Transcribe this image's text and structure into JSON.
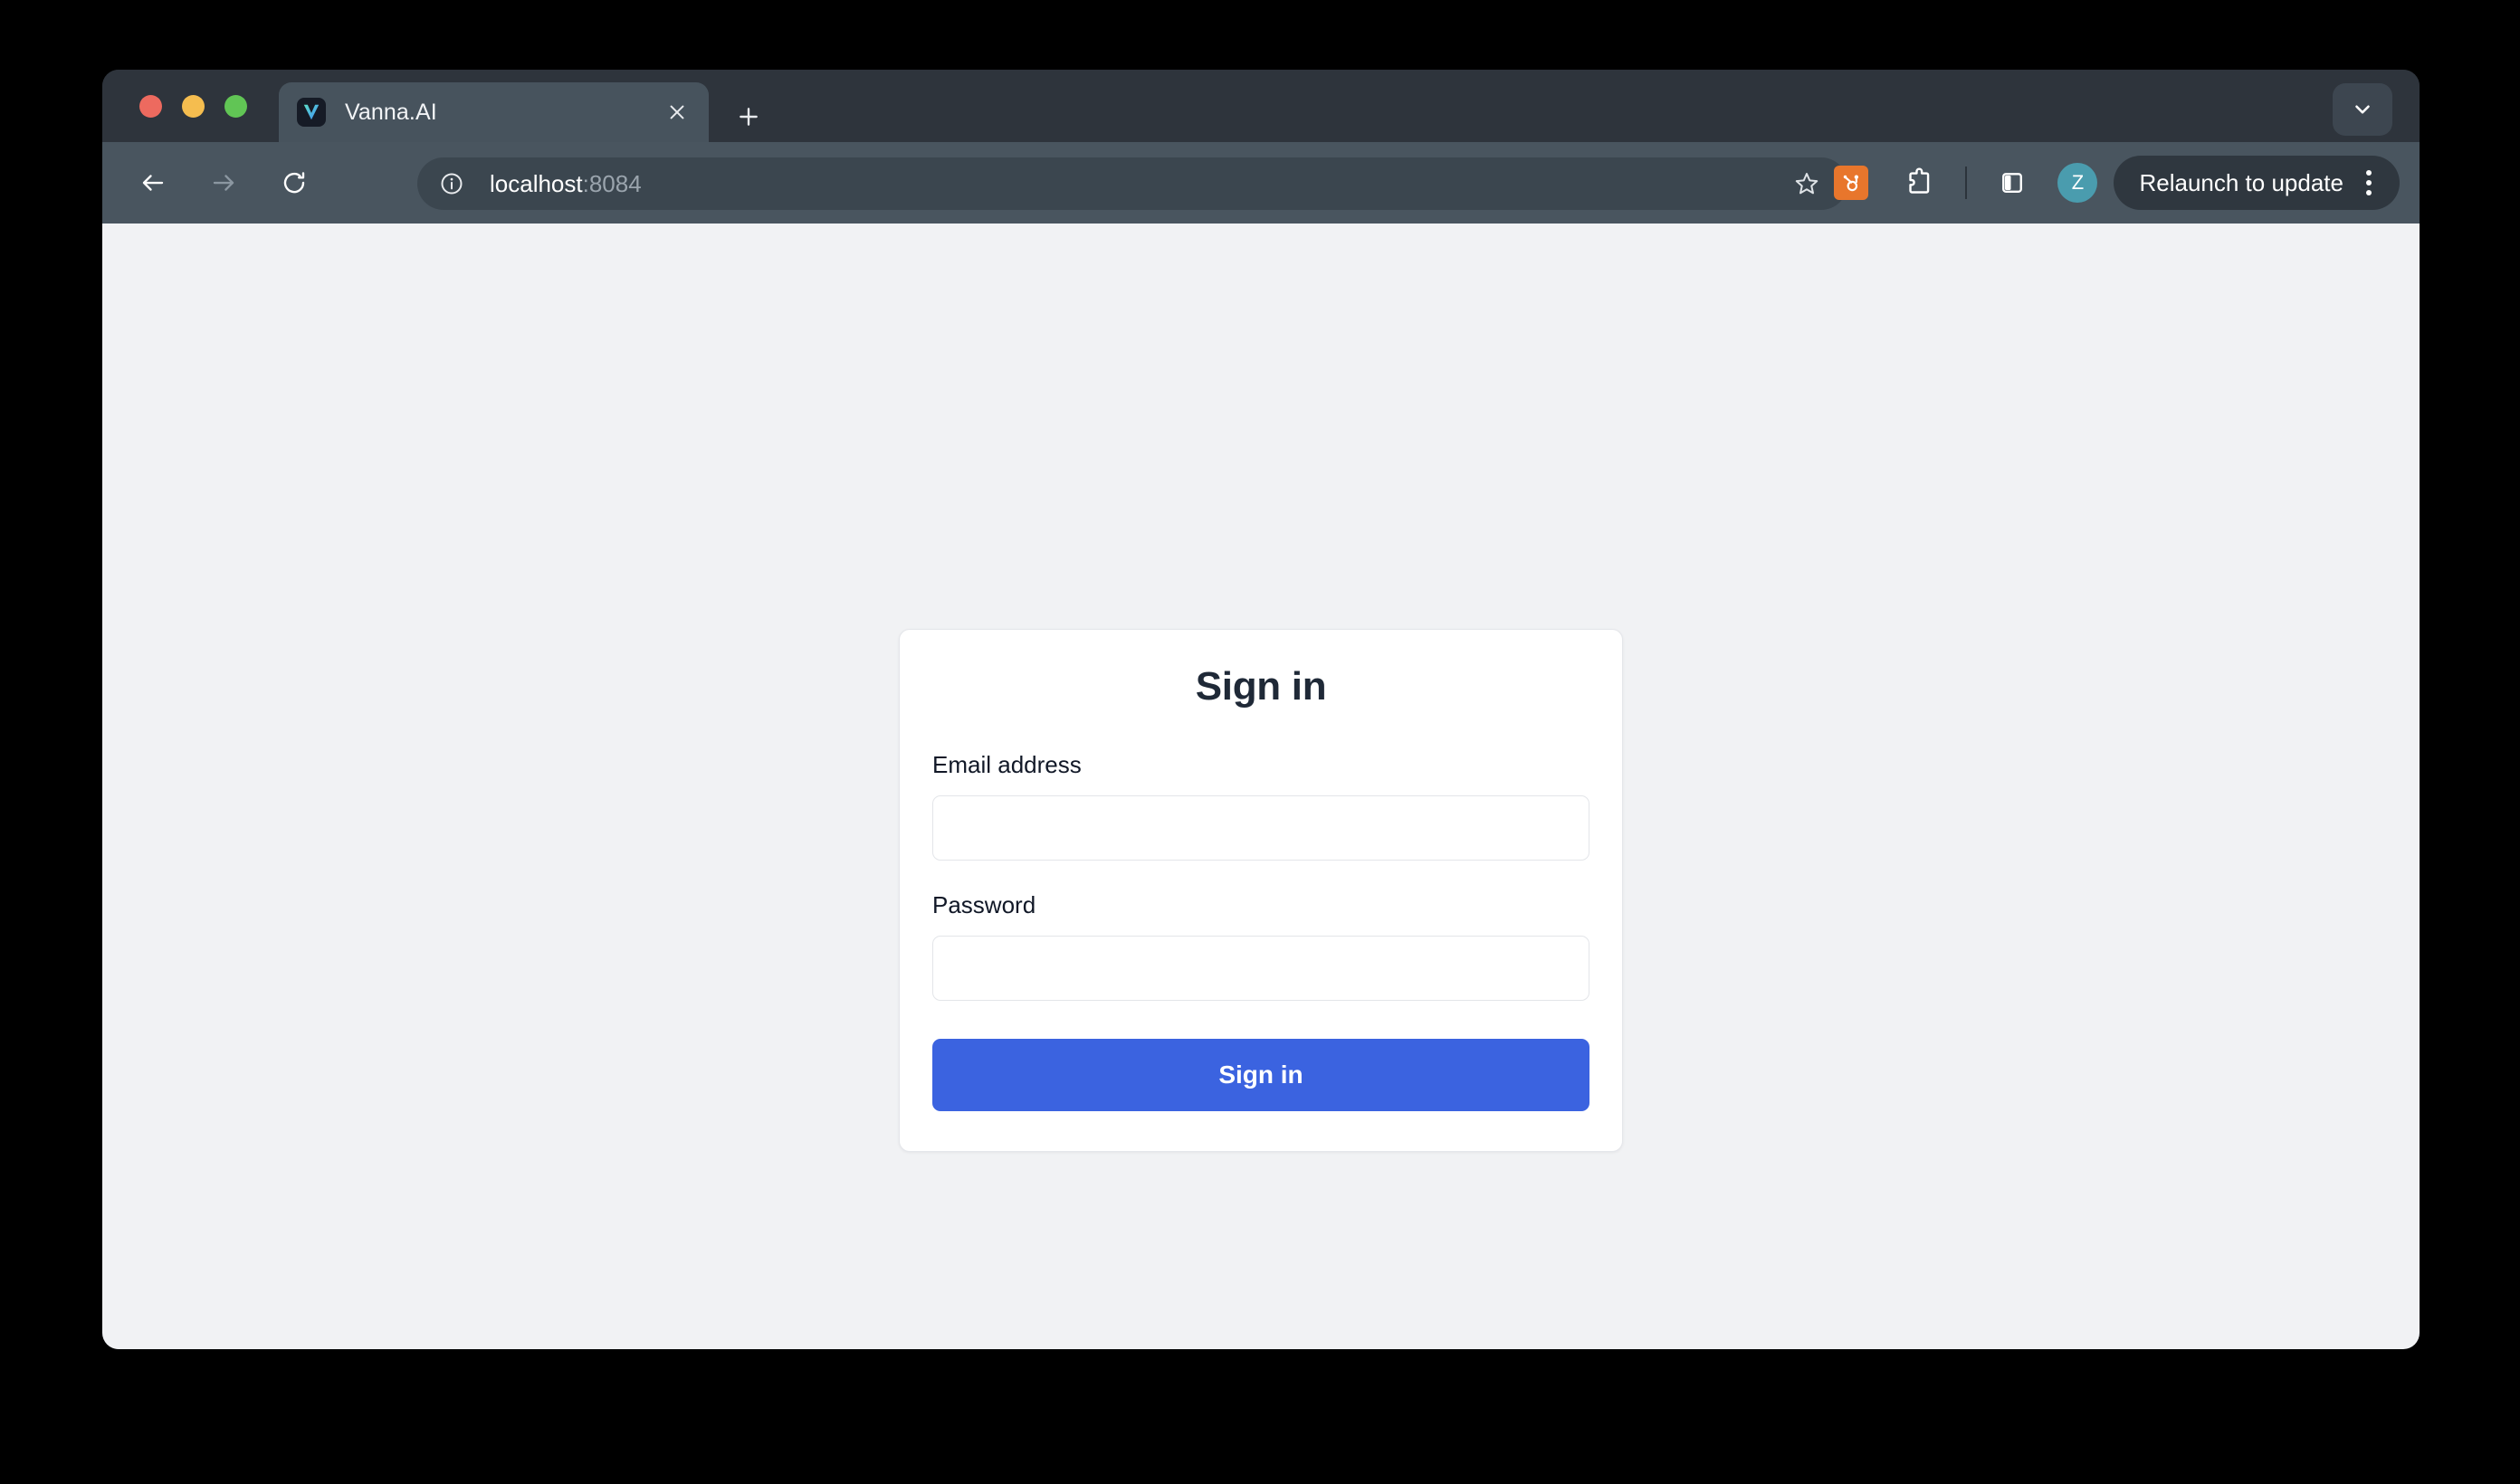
{
  "browser": {
    "window_controls": [
      {
        "name": "close",
        "color": "#ed6a5f"
      },
      {
        "name": "minimize",
        "color": "#f5bd4f"
      },
      {
        "name": "maximize",
        "color": "#61c555"
      }
    ],
    "tabs": [
      {
        "title": "Vanna.AI",
        "favicon": "vanna-v-logo",
        "active": true
      }
    ],
    "new_tab_label": "+",
    "close_tab_label": "×",
    "window_menu_icon": "chevron-down-icon",
    "navigation": {
      "back_icon": "arrow-left-icon",
      "forward_icon": "arrow-right-icon",
      "reload_icon": "reload-icon"
    },
    "omnibox": {
      "site_info_icon": "info-circle-icon",
      "url_host": "localhost",
      "url_port": ":8084",
      "bookmark_icon": "star-icon"
    },
    "toolbar_right": {
      "extension_hubspot": "hubspot-sprocket-icon",
      "extensions_icon": "puzzle-piece-icon",
      "side_panel_icon": "side-panel-icon",
      "avatar_initial": "Z",
      "relaunch_label": "Relaunch to update",
      "menu_icon": "three-dot-menu-icon"
    }
  },
  "page": {
    "signin": {
      "title": "Sign in",
      "fields": [
        {
          "label": "Email address",
          "value": "",
          "placeholder": "",
          "type": "email",
          "name": "email"
        },
        {
          "label": "Password",
          "value": "",
          "placeholder": "",
          "type": "password",
          "name": "password"
        }
      ],
      "submit_label": "Sign in"
    }
  },
  "colors": {
    "accent_button": "#3b63e0",
    "page_background": "#f1f2f4",
    "card_background": "#ffffff",
    "card_border": "#e4e6ea",
    "chrome_tabstrip": "#2e343c",
    "chrome_toolbar": "#49555f",
    "avatar": "#4a9cae",
    "hubspot_orange": "#e8762c"
  }
}
